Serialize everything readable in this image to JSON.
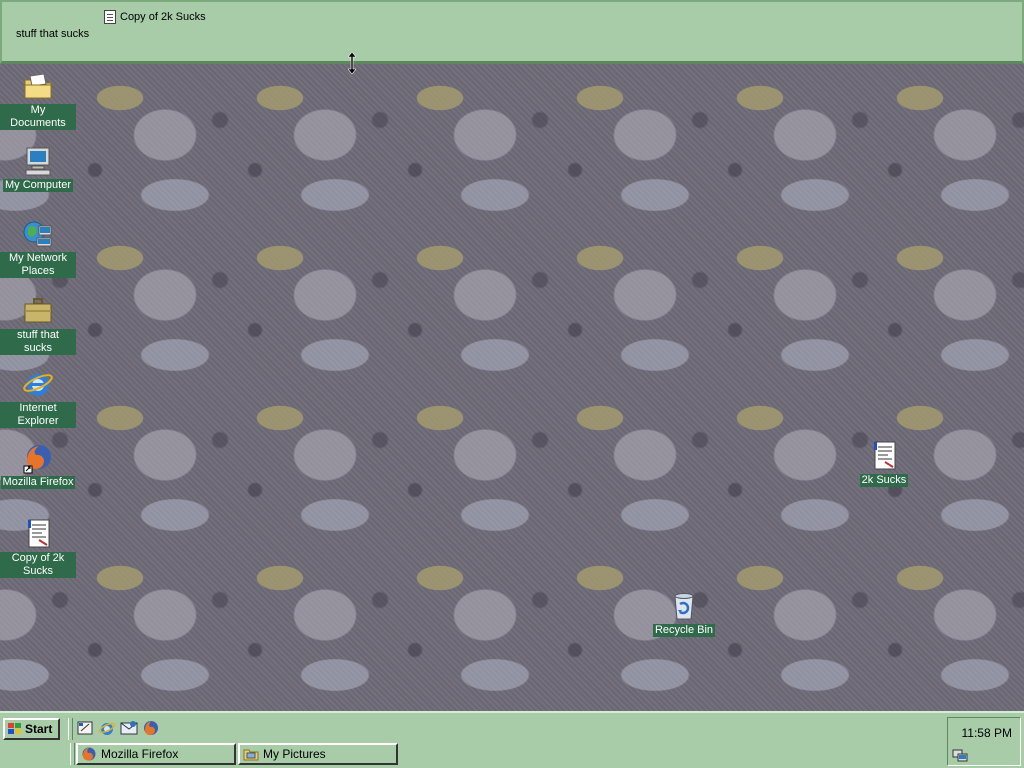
{
  "toolbar": {
    "label": "stuff that sucks",
    "item": "Copy of 2k Sucks"
  },
  "desktop_icons": {
    "my_documents": "My Documents",
    "my_computer": "My Computer",
    "my_network_places": "My Network Places",
    "stuff_that_sucks": "stuff that sucks",
    "internet_explorer": "Internet Explorer",
    "mozilla_firefox": "Mozilla Firefox",
    "copy_of_2k_sucks": "Copy of 2k Sucks",
    "two_k_sucks": "2k Sucks",
    "recycle_bin": "Recycle Bin"
  },
  "taskbar": {
    "start_label": "Start",
    "tasks": [
      {
        "label": "Mozilla Firefox",
        "icon": "firefox-icon"
      },
      {
        "label": "My Pictures",
        "icon": "folder-icon"
      }
    ],
    "clock": "11:58 PM"
  },
  "colors": {
    "taskbar": "#a7cca7",
    "label_bg": "#2f6b4a"
  }
}
